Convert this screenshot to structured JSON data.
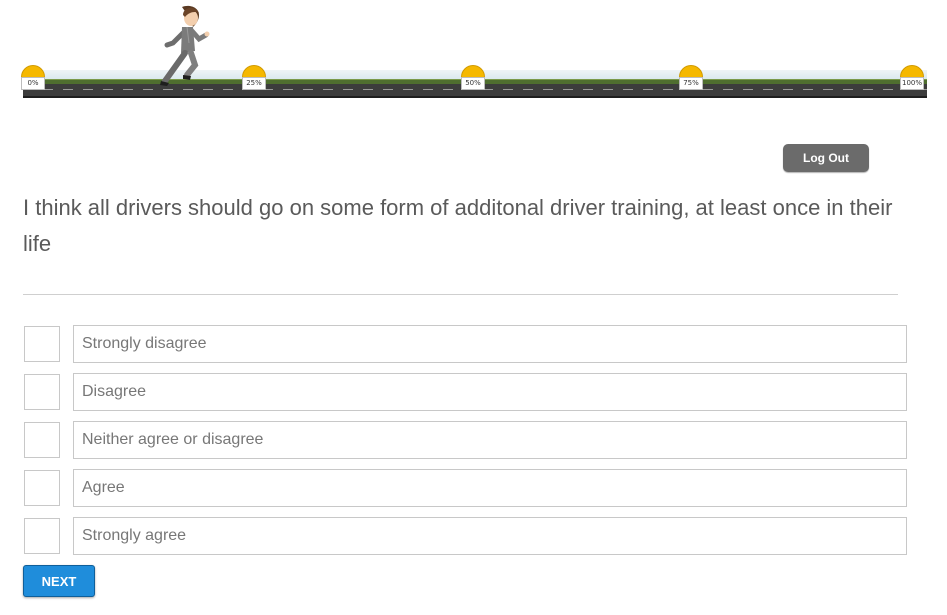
{
  "progress": {
    "current_fraction": 0.16,
    "milestones": [
      "0%",
      "25%",
      "50%",
      "75%",
      "100%"
    ]
  },
  "icons": {
    "runner": "running-woman-icon",
    "milestone": "milestone-marker-icon"
  },
  "colors": {
    "next_button": "#1f8ddb",
    "logout_button": "#6b6b6b",
    "milestone": "#f5b800"
  },
  "header": {
    "logout_label": "Log Out"
  },
  "question": {
    "text": "I think all drivers should go on some form of additonal driver training, at least once in their life"
  },
  "options": [
    {
      "label": "Strongly disagree",
      "checked": false
    },
    {
      "label": "Disagree",
      "checked": false
    },
    {
      "label": "Neither agree or disagree",
      "checked": false
    },
    {
      "label": "Agree",
      "checked": false
    },
    {
      "label": "Strongly agree",
      "checked": false
    }
  ],
  "footer": {
    "next_label": "NEXT"
  }
}
